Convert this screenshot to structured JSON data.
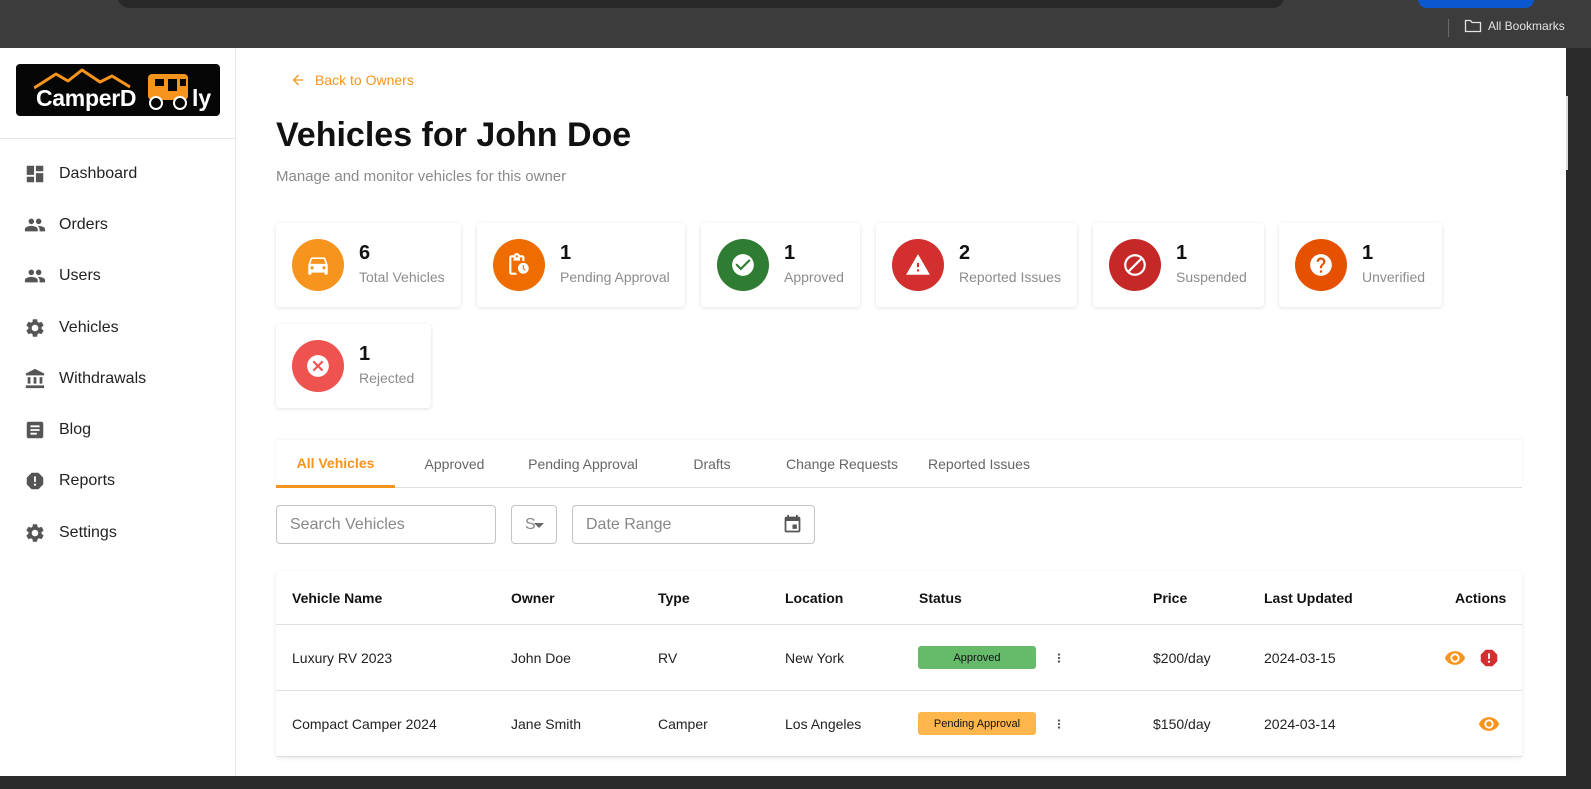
{
  "browser": {
    "bookmarks_label": "All Bookmarks"
  },
  "brand": {
    "logo_text": "CamperD",
    "logo_tail": "ly"
  },
  "sidebar": {
    "items": [
      {
        "label": "Dashboard",
        "icon": "dashboard-icon"
      },
      {
        "label": "Orders",
        "icon": "people-icon"
      },
      {
        "label": "Users",
        "icon": "people-icon"
      },
      {
        "label": "Vehicles",
        "icon": "gear-icon"
      },
      {
        "label": "Withdrawals",
        "icon": "bank-icon"
      },
      {
        "label": "Blog",
        "icon": "article-icon"
      },
      {
        "label": "Reports",
        "icon": "report-icon"
      },
      {
        "label": "Settings",
        "icon": "gear-icon"
      }
    ]
  },
  "header": {
    "back_label": "Back to Owners",
    "title": "Vehicles for John Doe",
    "subtitle": "Manage and monitor vehicles for this owner"
  },
  "stats": [
    {
      "value": "6",
      "label": "Total Vehicles",
      "color": "#f7941d",
      "icon": "car-icon"
    },
    {
      "value": "1",
      "label": "Pending Approval",
      "color": "#ef6c00",
      "icon": "clipboard-clock-icon"
    },
    {
      "value": "1",
      "label": "Approved",
      "color": "#2e7d32",
      "icon": "check-circle-icon"
    },
    {
      "value": "2",
      "label": "Reported Issues",
      "color": "#d32f2f",
      "icon": "warning-icon"
    },
    {
      "value": "1",
      "label": "Suspended",
      "color": "#c62828",
      "icon": "block-icon"
    },
    {
      "value": "1",
      "label": "Unverified",
      "color": "#e65100",
      "icon": "help-icon"
    },
    {
      "value": "1",
      "label": "Rejected",
      "color": "#ef5350",
      "icon": "cancel-icon"
    }
  ],
  "tabs": [
    "All Vehicles",
    "Approved",
    "Pending Approval",
    "Drafts",
    "Change Requests",
    "Reported Issues"
  ],
  "filters": {
    "search_placeholder": "Search Vehicles",
    "status_placeholder": "S",
    "date_placeholder": "Date Range"
  },
  "table": {
    "columns": [
      "Vehicle Name",
      "Owner",
      "Type",
      "Location",
      "Status",
      "Price",
      "Last Updated",
      "Actions"
    ],
    "rows": [
      {
        "name": "Luxury RV 2023",
        "owner": "John Doe",
        "type": "RV",
        "location": "New York",
        "status": "Approved",
        "status_color": "#66bb6a",
        "price": "$200/day",
        "updated": "2024-03-15"
      },
      {
        "name": "Compact Camper 2024",
        "owner": "Jane Smith",
        "type": "Camper",
        "location": "Los Angeles",
        "status": "Pending Approval",
        "status_color": "#ffb74d",
        "price": "$150/day",
        "updated": "2024-03-14"
      }
    ]
  }
}
